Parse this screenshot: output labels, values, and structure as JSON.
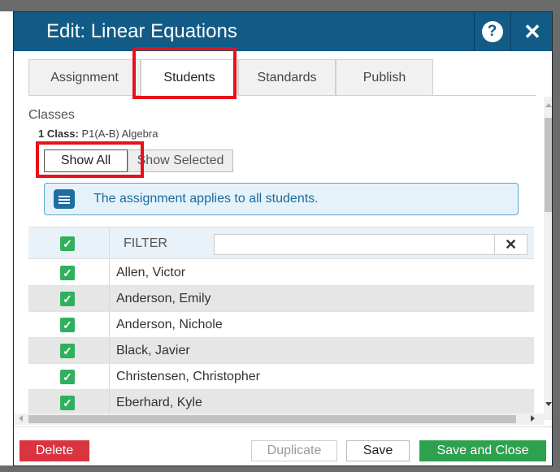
{
  "dialog": {
    "title": "Edit: Linear Equations",
    "help_icon_glyph": "?",
    "close_icon_glyph": "✕"
  },
  "tabs": [
    {
      "label": "Assignment",
      "active": false
    },
    {
      "label": "Students",
      "active": true
    },
    {
      "label": "Standards",
      "active": false
    },
    {
      "label": "Publish",
      "active": false
    }
  ],
  "classes": {
    "label": "Classes",
    "count_label": "1 Class:",
    "class_name": "P1(A-B) Algebra"
  },
  "view_toggle": {
    "show_all": "Show All",
    "show_selected": "Show Selected",
    "selected": "Show All"
  },
  "info": {
    "message": "The assignment applies to all students.",
    "icon": "chat-bubble-icon"
  },
  "grid": {
    "filter_label": "FILTER",
    "filter_value": "",
    "clear_glyph": "✕",
    "check_glyph": "✓",
    "students": [
      {
        "name": "Allen, Victor",
        "checked": true
      },
      {
        "name": "Anderson, Emily",
        "checked": true
      },
      {
        "name": "Anderson, Nichole",
        "checked": true
      },
      {
        "name": "Black, Javier",
        "checked": true
      },
      {
        "name": "Christensen, Christopher",
        "checked": true
      },
      {
        "name": "Eberhard, Kyle",
        "checked": true
      }
    ]
  },
  "footer": {
    "delete": "Delete",
    "duplicate": "Duplicate",
    "save": "Save",
    "save_and_close": "Save and Close"
  },
  "colors": {
    "title_bar": "#125b86",
    "check_green": "#2fb05d",
    "delete_red": "#d9343f",
    "save_close_green": "#2ea14f",
    "highlight_red": "#e8101a"
  }
}
